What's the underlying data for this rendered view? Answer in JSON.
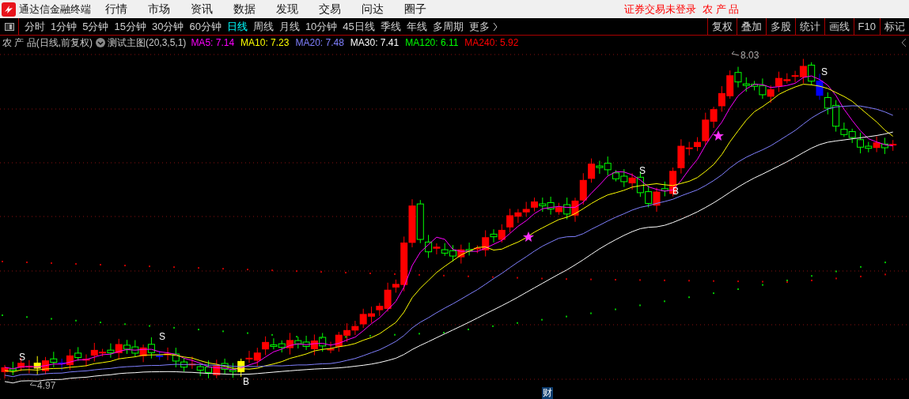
{
  "menu_bar": {
    "app_title": "通达信金融终端",
    "menu_items": [
      "行情",
      "市场",
      "资讯",
      "数据",
      "发现",
      "交易",
      "问达",
      "圈子"
    ],
    "login_status": "证券交易未登录",
    "stock_name": "农 产 品"
  },
  "period_tabs": [
    {
      "label": "分时",
      "selected": false
    },
    {
      "label": "1分钟",
      "selected": false
    },
    {
      "label": "5分钟",
      "selected": false
    },
    {
      "label": "15分钟",
      "selected": false
    },
    {
      "label": "30分钟",
      "selected": false
    },
    {
      "label": "60分钟",
      "selected": false
    },
    {
      "label": "日线",
      "selected": true
    },
    {
      "label": "周线",
      "selected": false
    },
    {
      "label": "月线",
      "selected": false
    },
    {
      "label": "10分钟",
      "selected": false
    },
    {
      "label": "45日线",
      "selected": false
    },
    {
      "label": "季线",
      "selected": false
    },
    {
      "label": "年线",
      "selected": false
    },
    {
      "label": "多周期",
      "selected": false
    },
    {
      "label": "更多",
      "selected": false
    }
  ],
  "toolbar_buttons": [
    "复权",
    "叠加",
    "多股",
    "统计",
    "画线",
    "F10",
    "标记"
  ],
  "chart": {
    "security": "农 产 品(日线,前复权)",
    "indicator": "测试主图(20,3,5,1)",
    "ma_legend": [
      {
        "label": "MA5: 7.14",
        "color": "#ff00ff"
      },
      {
        "label": "MA10: 7.23",
        "color": "#ffff00"
      },
      {
        "label": "MA20: 7.48",
        "color": "#8080ff"
      },
      {
        "label": "MA30: 7.41",
        "color": "#ffffff"
      },
      {
        "label": "MA120: 6.11",
        "color": "#00ff00"
      },
      {
        "label": "MA240: 5.92",
        "color": "#ff0000"
      }
    ],
    "signals": [
      "S",
      "S",
      "B",
      "S",
      "B",
      "S"
    ],
    "price_labels": [
      "8.03",
      "4.97"
    ],
    "badge": "财"
  }
}
